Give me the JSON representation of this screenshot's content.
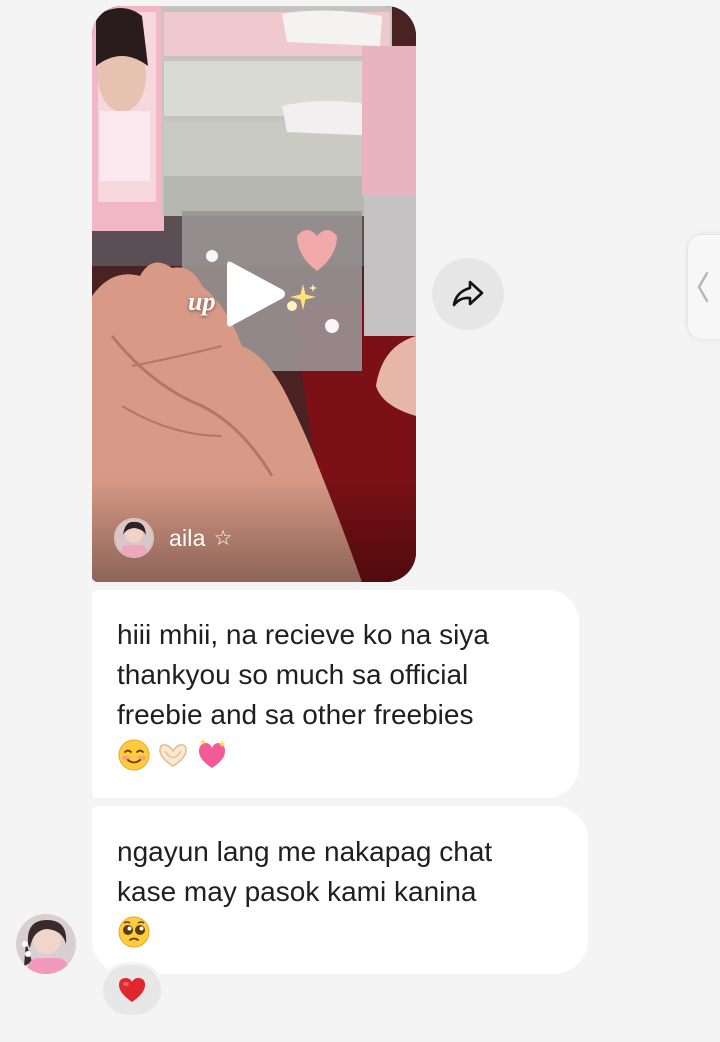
{
  "reel": {
    "caption_visible": "up",
    "author_name": "aila",
    "author_badge": "☆",
    "play_icon": "play-icon",
    "share_icon": "share-arrow-icon"
  },
  "edge_tab": {
    "icon": "chevron-left-icon"
  },
  "messages": [
    {
      "lines": [
        "hiii mhii, na recieve ko na siya",
        "thankyou so much sa official",
        "freebie and sa other freebies"
      ],
      "emojis": [
        "smiling-blush-emoji",
        "heart-hands-emoji",
        "sparkling-heart-emoji"
      ]
    },
    {
      "lines": [
        "ngayun lang me nakapag chat",
        "kase may pasok kami kanina"
      ],
      "emojis": [
        "pleading-face-emoji"
      ]
    }
  ],
  "reaction": {
    "emoji": "red-heart-emoji"
  },
  "colors": {
    "background": "#f4f4f4",
    "bubble": "#ffffff",
    "text": "#1f1f1f",
    "reaction_heart": "#e0262e"
  }
}
